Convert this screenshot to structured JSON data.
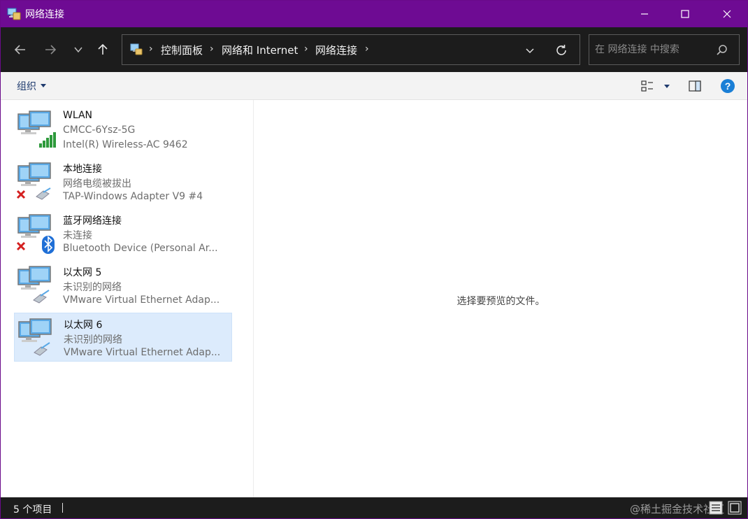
{
  "window": {
    "title": "网络连接",
    "accent": "#6e0b93"
  },
  "nav": {
    "breadcrumbs": [
      "控制面板",
      "网络和 Internet",
      "网络连接"
    ],
    "search_placeholder": "在 网络连接 中搜索"
  },
  "toolbar": {
    "organize_label": "组织"
  },
  "connections": [
    {
      "name": "WLAN",
      "status": "CMCC-6Ysz-5G",
      "device": "Intel(R) Wireless-AC 9462",
      "icon": "wireless-signal-icon"
    },
    {
      "name": "本地连接",
      "status": "网络电缆被拔出",
      "device": "TAP-Windows Adapter V9 #4",
      "icon": "ethernet-disconnected-icon"
    },
    {
      "name": "蓝牙网络连接",
      "status": "未连接",
      "device": "Bluetooth Device (Personal Ar...",
      "icon": "bluetooth-disconnected-icon"
    },
    {
      "name": "以太网 5",
      "status": "未识别的网络",
      "device": "VMware Virtual Ethernet Adap...",
      "icon": "ethernet-icon"
    },
    {
      "name": "以太网 6",
      "status": "未识别的网络",
      "device": "VMware Virtual Ethernet Adap...",
      "icon": "ethernet-icon",
      "selected": true
    }
  ],
  "preview": {
    "message": "选择要预览的文件。"
  },
  "statusbar": {
    "item_count": "5 个项目"
  },
  "watermark": "@稀土掘金技术社区"
}
